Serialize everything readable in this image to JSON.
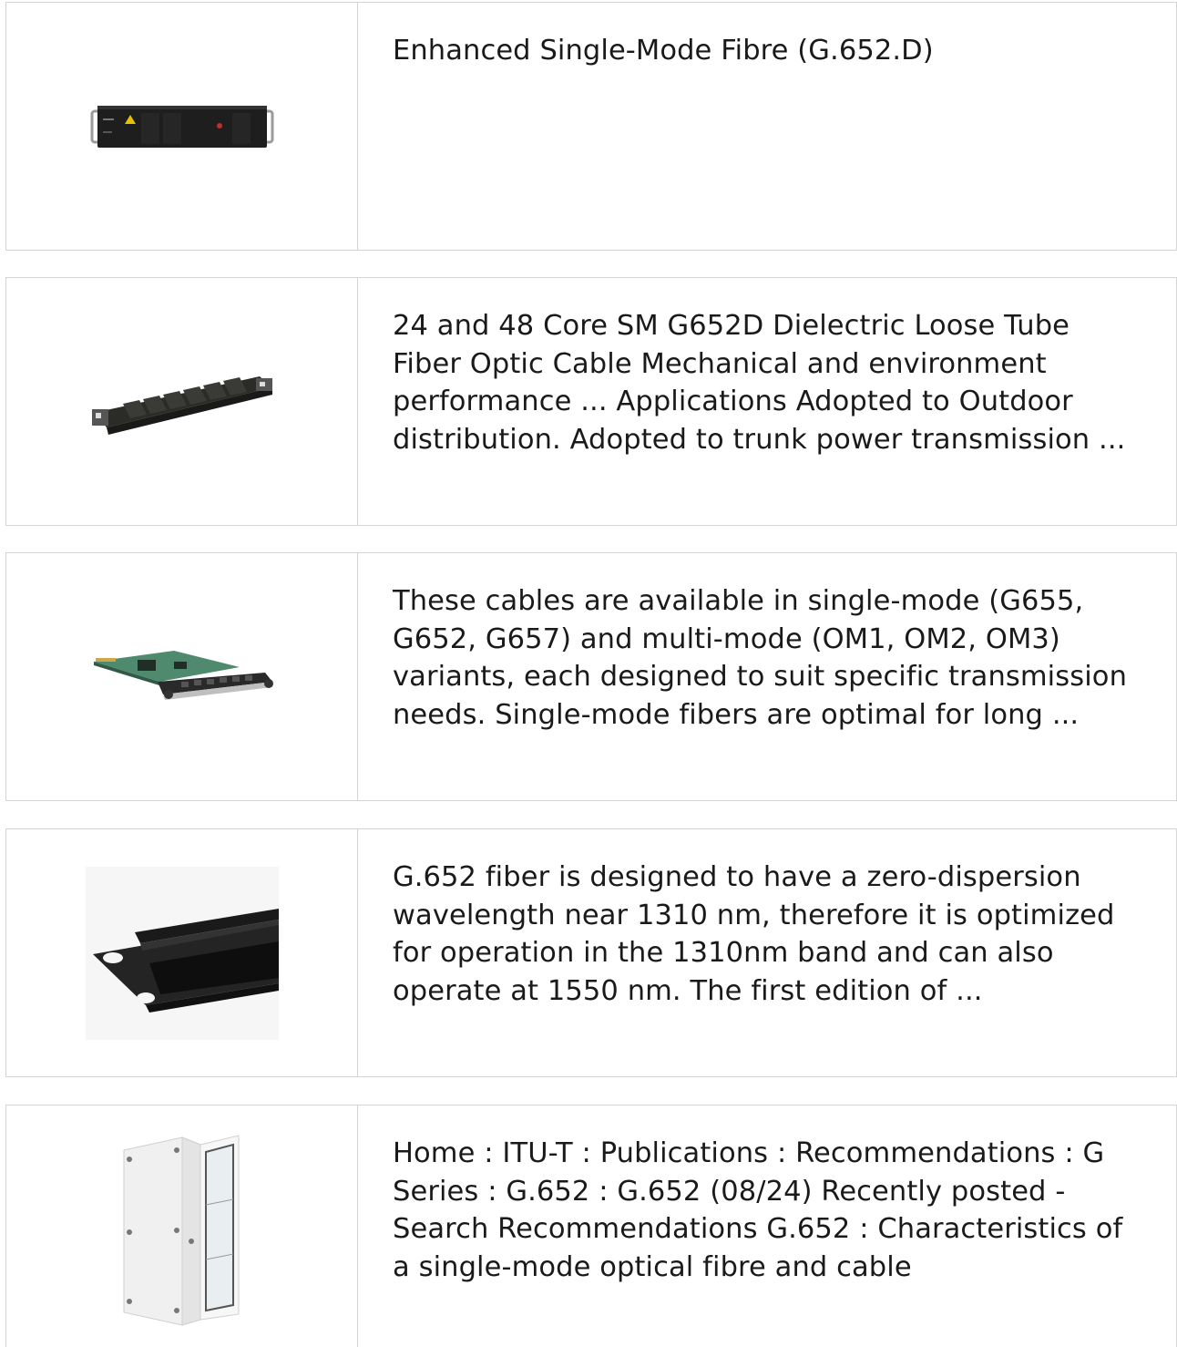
{
  "results": [
    {
      "thumbnail": "rack-mount-chassis-image",
      "snippet": "Enhanced Single-Mode Fibre (G.652.D)"
    },
    {
      "thumbnail": "fiber-splice-closure-image",
      "snippet": "24 and 48 Core SM G652D Dielectric Loose Tube Fiber Optic Cable Mechanical and environment performance ... Applications Adopted to Outdoor distribution. Adopted to trunk power transmission ..."
    },
    {
      "thumbnail": "line-card-module-image",
      "snippet": "These cables are available in single-mode (G655, G652, G657) and multi-mode (OM1, OM2, OM3) variants, each designed to suit specific transmission needs. Single-mode fibers are optimal for long ..."
    },
    {
      "thumbnail": "brush-panel-image",
      "snippet": "G.652 fiber is designed to have a zero-dispersion wavelength near 1310 nm, therefore it is optimized for operation in the 1310nm band and can also operate at 1550 nm. The first edition of ..."
    },
    {
      "thumbnail": "white-cabinet-image",
      "snippet": "Home : ITU-T : Publications : Recommendations : G Series : G.652 : G.652 (08/24) Recently posted - Search Recommendations G.652 : Characteristics of a single-mode optical fibre and cable"
    }
  ]
}
